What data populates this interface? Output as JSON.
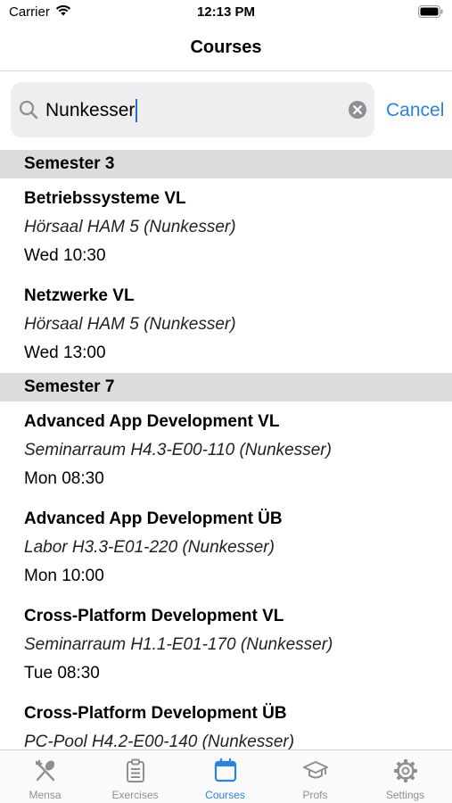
{
  "status_bar": {
    "carrier": "Carrier",
    "time": "12:13 PM"
  },
  "nav": {
    "title": "Courses"
  },
  "search": {
    "value": "Nunkesser",
    "cancel_label": "Cancel",
    "icon": "search-icon",
    "clear_icon": "clear-icon"
  },
  "sections": [
    {
      "header": "Semester 3",
      "courses": [
        {
          "name": "Betriebssysteme VL",
          "room": "Hörsaal HAM 5 (Nunkesser)",
          "time": "Wed 10:30"
        },
        {
          "name": "Netzwerke VL",
          "room": "Hörsaal HAM 5 (Nunkesser)",
          "time": "Wed 13:00"
        }
      ]
    },
    {
      "header": "Semester 7",
      "courses": [
        {
          "name": "Advanced App Development VL",
          "room": "Seminarraum H4.3-E00-110 (Nunkesser)",
          "time": "Mon 08:30"
        },
        {
          "name": "Advanced App Development ÜB",
          "room": "Labor H3.3-E01-220 (Nunkesser)",
          "time": "Mon 10:00"
        },
        {
          "name": "Cross-Platform Development VL",
          "room": "Seminarraum H1.1-E01-170 (Nunkesser)",
          "time": "Tue 08:30"
        },
        {
          "name": "Cross-Platform Development ÜB",
          "room": "PC-Pool H4.2-E00-140 (Nunkesser)",
          "time": ""
        }
      ]
    }
  ],
  "tabs": [
    {
      "label": "Mensa",
      "icon": "fork-knife-icon",
      "active": false
    },
    {
      "label": "Exercises",
      "icon": "clipboard-icon",
      "active": false
    },
    {
      "label": "Courses",
      "icon": "calendar-icon",
      "active": true
    },
    {
      "label": "Profs",
      "icon": "graduation-cap-icon",
      "active": false
    },
    {
      "label": "Settings",
      "icon": "gear-icon",
      "active": false
    }
  ],
  "colors": {
    "accent": "#2584e6",
    "inactive": "#8e8e93",
    "section_header_bg": "#dcdcdc",
    "search_bg": "#eeeef0"
  }
}
